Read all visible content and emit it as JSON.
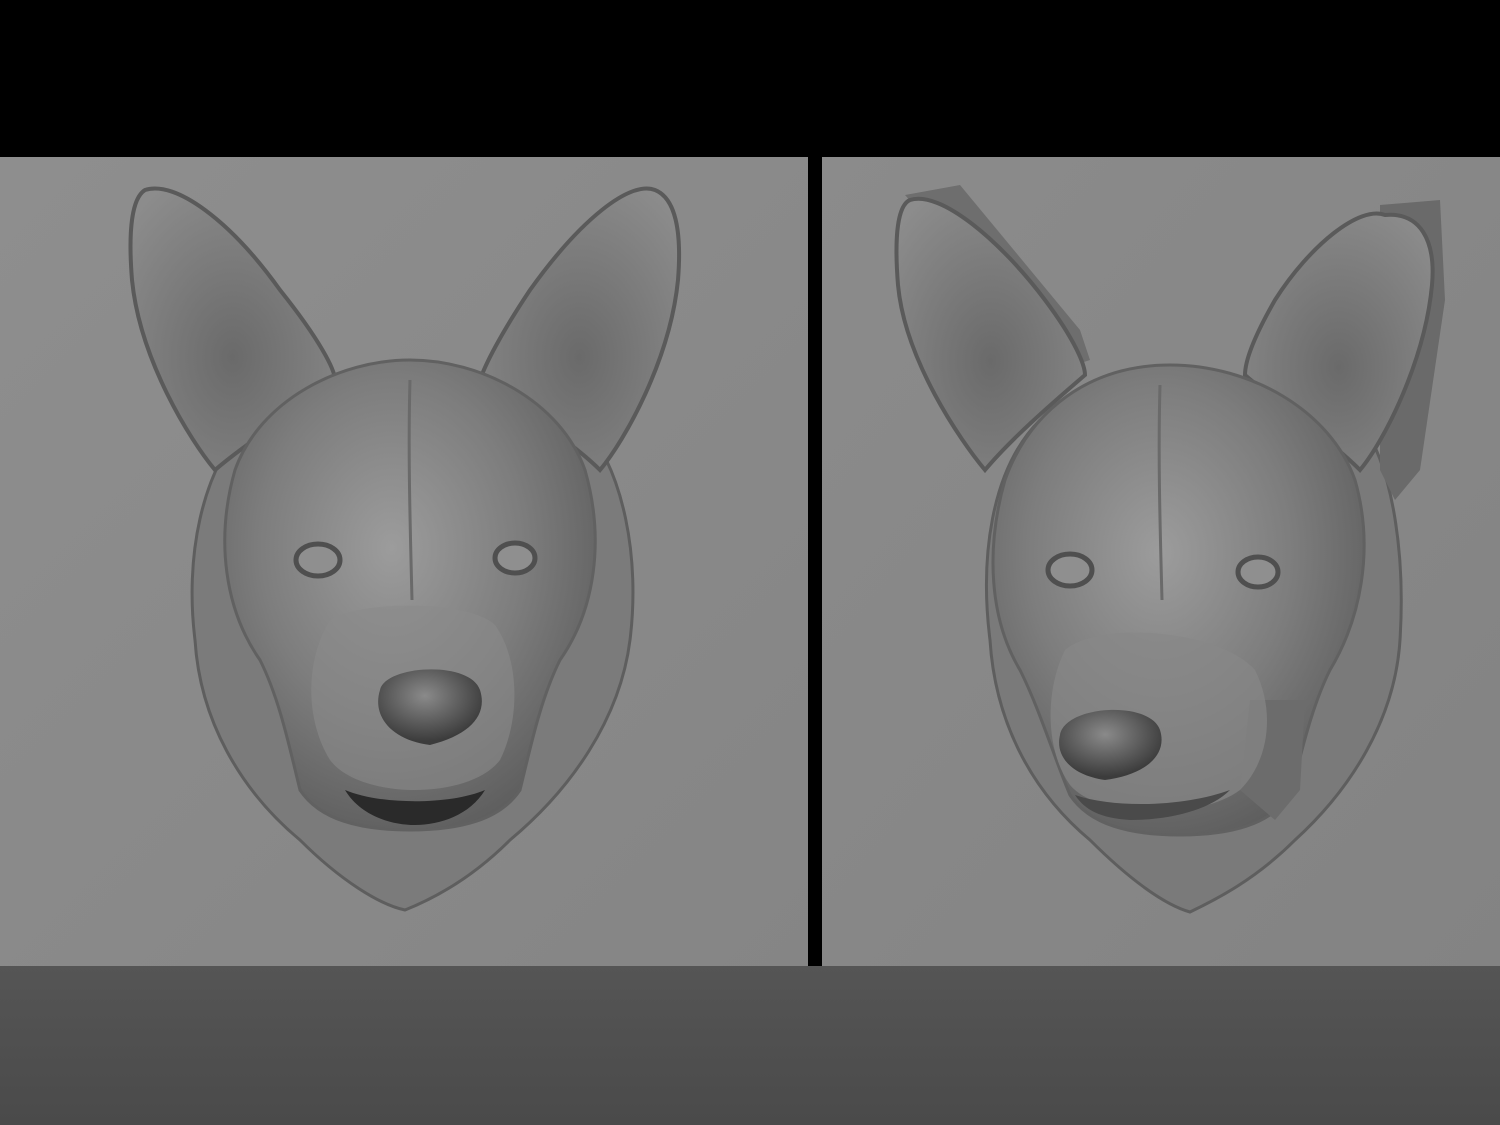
{
  "scene": {
    "background_top": "#000000",
    "floor_color": "#4d4d4d",
    "panel_color": "#8a8a8a",
    "model_color": "#7a7a7a"
  },
  "panels": [
    {
      "name": "left-relief-panel",
      "subject": "dog-head-relief-front-view"
    },
    {
      "name": "right-relief-panel",
      "subject": "dog-head-relief-angled-view"
    }
  ]
}
